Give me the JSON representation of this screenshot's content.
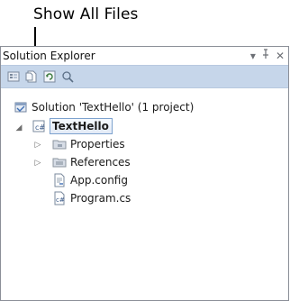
{
  "callout": {
    "label": "Show All Files"
  },
  "panel": {
    "title": "Solution Explorer",
    "controls": {
      "dropdown": "▾",
      "pin": "⊥",
      "close": "✕"
    }
  },
  "toolbar": {
    "buttons": [
      {
        "name": "properties-button",
        "icon": "properties-icon"
      },
      {
        "name": "show-all-files-button",
        "icon": "show-all-files-icon"
      },
      {
        "name": "refresh-button",
        "icon": "refresh-icon"
      },
      {
        "name": "view-class-diagram-button",
        "icon": "class-diagram-icon"
      }
    ]
  },
  "tree": {
    "solution": "Solution 'TextHello' (1 project)",
    "project": "TextHello",
    "items": [
      {
        "label": "Properties",
        "icon": "properties-folder-icon",
        "expandable": true
      },
      {
        "label": "References",
        "icon": "references-folder-icon",
        "expandable": true
      },
      {
        "label": "App.config",
        "icon": "config-file-icon",
        "expandable": false
      },
      {
        "label": "Program.cs",
        "icon": "csharp-file-icon",
        "expandable": false
      }
    ]
  }
}
